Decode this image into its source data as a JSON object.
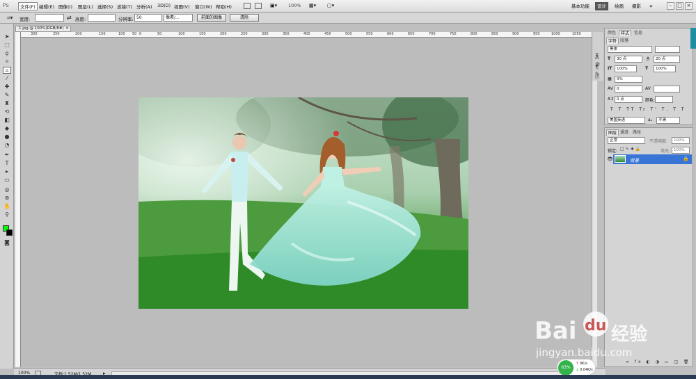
{
  "menubar": {
    "logo": "Ps",
    "items": [
      "文件(F)",
      "编辑(E)",
      "图像(I)",
      "图层(L)",
      "选择(S)",
      "滤镜(T)",
      "分析(A)",
      "3D(D)",
      "视图(V)",
      "窗口(W)",
      "帮助(H)"
    ],
    "zoom": "100%",
    "workspaces": [
      "基本功能",
      "设计",
      "绘画",
      "摄影"
    ],
    "more": "»"
  },
  "options": {
    "width_label": "宽度:",
    "height_label": "高度:",
    "resolution_label": "分辨率:",
    "resolution_value": "50",
    "unit": "像素/...",
    "front_image_button": "前面的图像",
    "clear_button": "清除"
  },
  "document": {
    "tab_title": "1.jpg @ 100%(RGB/8#)",
    "ruler_ticks": [
      "300",
      "250",
      "200",
      "150",
      "100",
      "50",
      "0",
      "50",
      "100",
      "150",
      "200",
      "250",
      "300",
      "350",
      "400",
      "450",
      "500",
      "550",
      "600",
      "650",
      "700",
      "750",
      "800",
      "850",
      "900",
      "950",
      "1000",
      "1050"
    ]
  },
  "status": {
    "zoom": "100%",
    "doc_size": "文档:1.52M/1.52M"
  },
  "char_panel": {
    "top_tabs": [
      "颜色",
      "样式",
      "信息"
    ],
    "sub_tabs": [
      "字符",
      "段落"
    ],
    "font_family": "黑体",
    "font_style": "-",
    "font_size": "30 点",
    "leading": "20 点",
    "vscale": "100%",
    "hscale": "100%",
    "tracking_percent": "0%",
    "kerning": "0",
    "baseline": "0 点",
    "color_label": "颜色:",
    "language": "美国英语",
    "antialias": "平滑",
    "type_styles": [
      "T",
      "T",
      "TT",
      "Tr",
      "T'",
      "T,",
      "T",
      "T"
    ]
  },
  "layers_panel": {
    "tabs": [
      "图层",
      "通道",
      "路径"
    ],
    "blend_mode": "正常",
    "opacity_label": "不透明度:",
    "opacity": "100%",
    "lock_label": "锁定:",
    "fill_label": "填充:",
    "fill": "100%",
    "layer_name": "背景"
  },
  "speed_widget": {
    "percent": "63%",
    "up": "0K/s",
    "down": "0.04K/s"
  },
  "watermark": {
    "brand": "Bai",
    "brand2": "du",
    "product": "经验",
    "url": "jingyan.baidu.com"
  }
}
